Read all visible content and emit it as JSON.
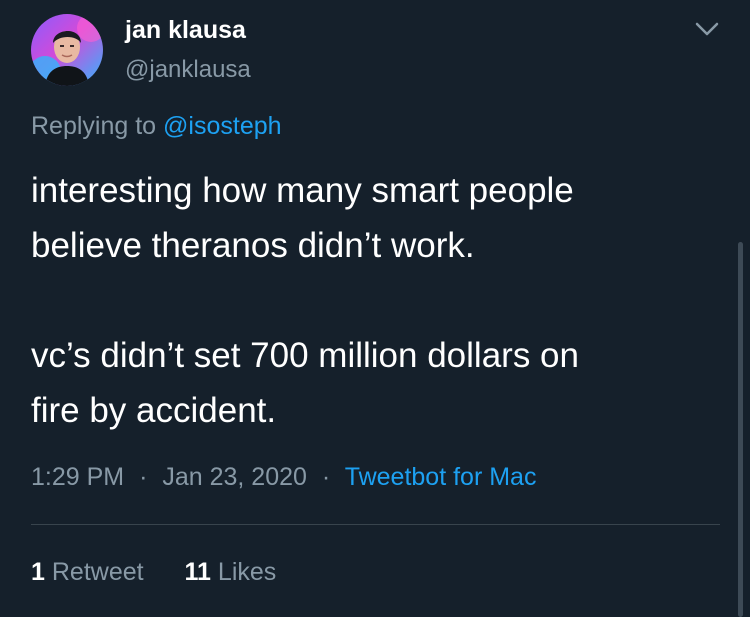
{
  "author": {
    "display_name": "jan klausa",
    "handle": "@janklausa"
  },
  "reply_context": {
    "prefix": "Replying to",
    "mention": "@isosteph"
  },
  "tweet": {
    "lines": [
      "interesting how many smart people",
      "believe theranos didn’t work.",
      "",
      "vc’s didn’t set 700 million dollars on",
      "fire by accident."
    ]
  },
  "meta": {
    "time": "1:29 PM",
    "separator": "·",
    "date": "Jan 23, 2020",
    "source": "Tweetbot for Mac"
  },
  "stats": {
    "retweets_count": "1",
    "retweets_label": "Retweet",
    "likes_count": "11",
    "likes_label": "Likes"
  },
  "icons": {
    "menu": "chevron-down-icon"
  },
  "colors": {
    "background": "#15202b",
    "secondary_text": "#8899a6",
    "accent": "#1da1f2",
    "divider": "#38444d"
  }
}
